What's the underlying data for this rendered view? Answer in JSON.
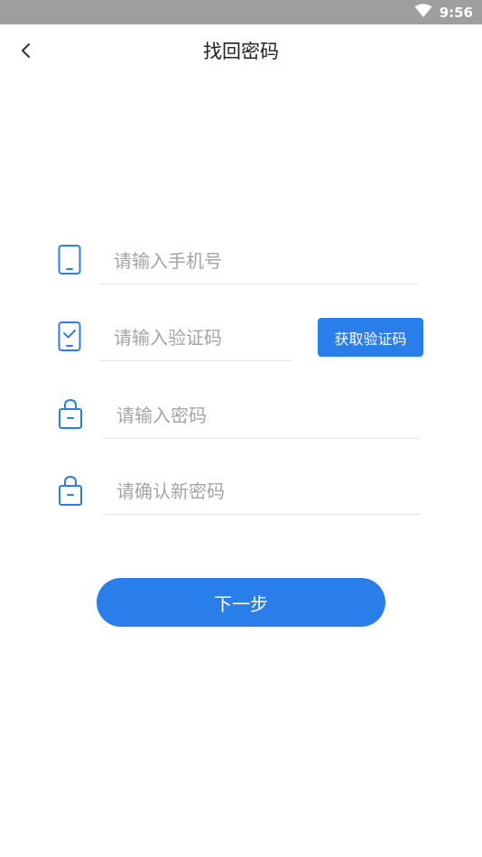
{
  "status_bar": {
    "time": "9:56",
    "wifi_icon": "wifi-icon"
  },
  "header": {
    "back_icon": "chevron-left-icon",
    "title": "找回密码"
  },
  "form": {
    "phone": {
      "icon": "phone-icon",
      "placeholder": "请输入手机号",
      "value": ""
    },
    "code": {
      "icon": "sms-verify-icon",
      "placeholder": "请输入验证码",
      "value": "",
      "button_label": "获取验证码"
    },
    "password": {
      "icon": "lock-icon",
      "placeholder": "请输入密码",
      "value": ""
    },
    "confirm_password": {
      "icon": "lock-icon",
      "placeholder": "请确认新密码",
      "value": ""
    }
  },
  "actions": {
    "next_label": "下一步"
  },
  "colors": {
    "accent": "#2a7eea",
    "status_bar": "#9e9e9e",
    "placeholder": "#a4a4a4",
    "divider": "#e6e6e6"
  }
}
